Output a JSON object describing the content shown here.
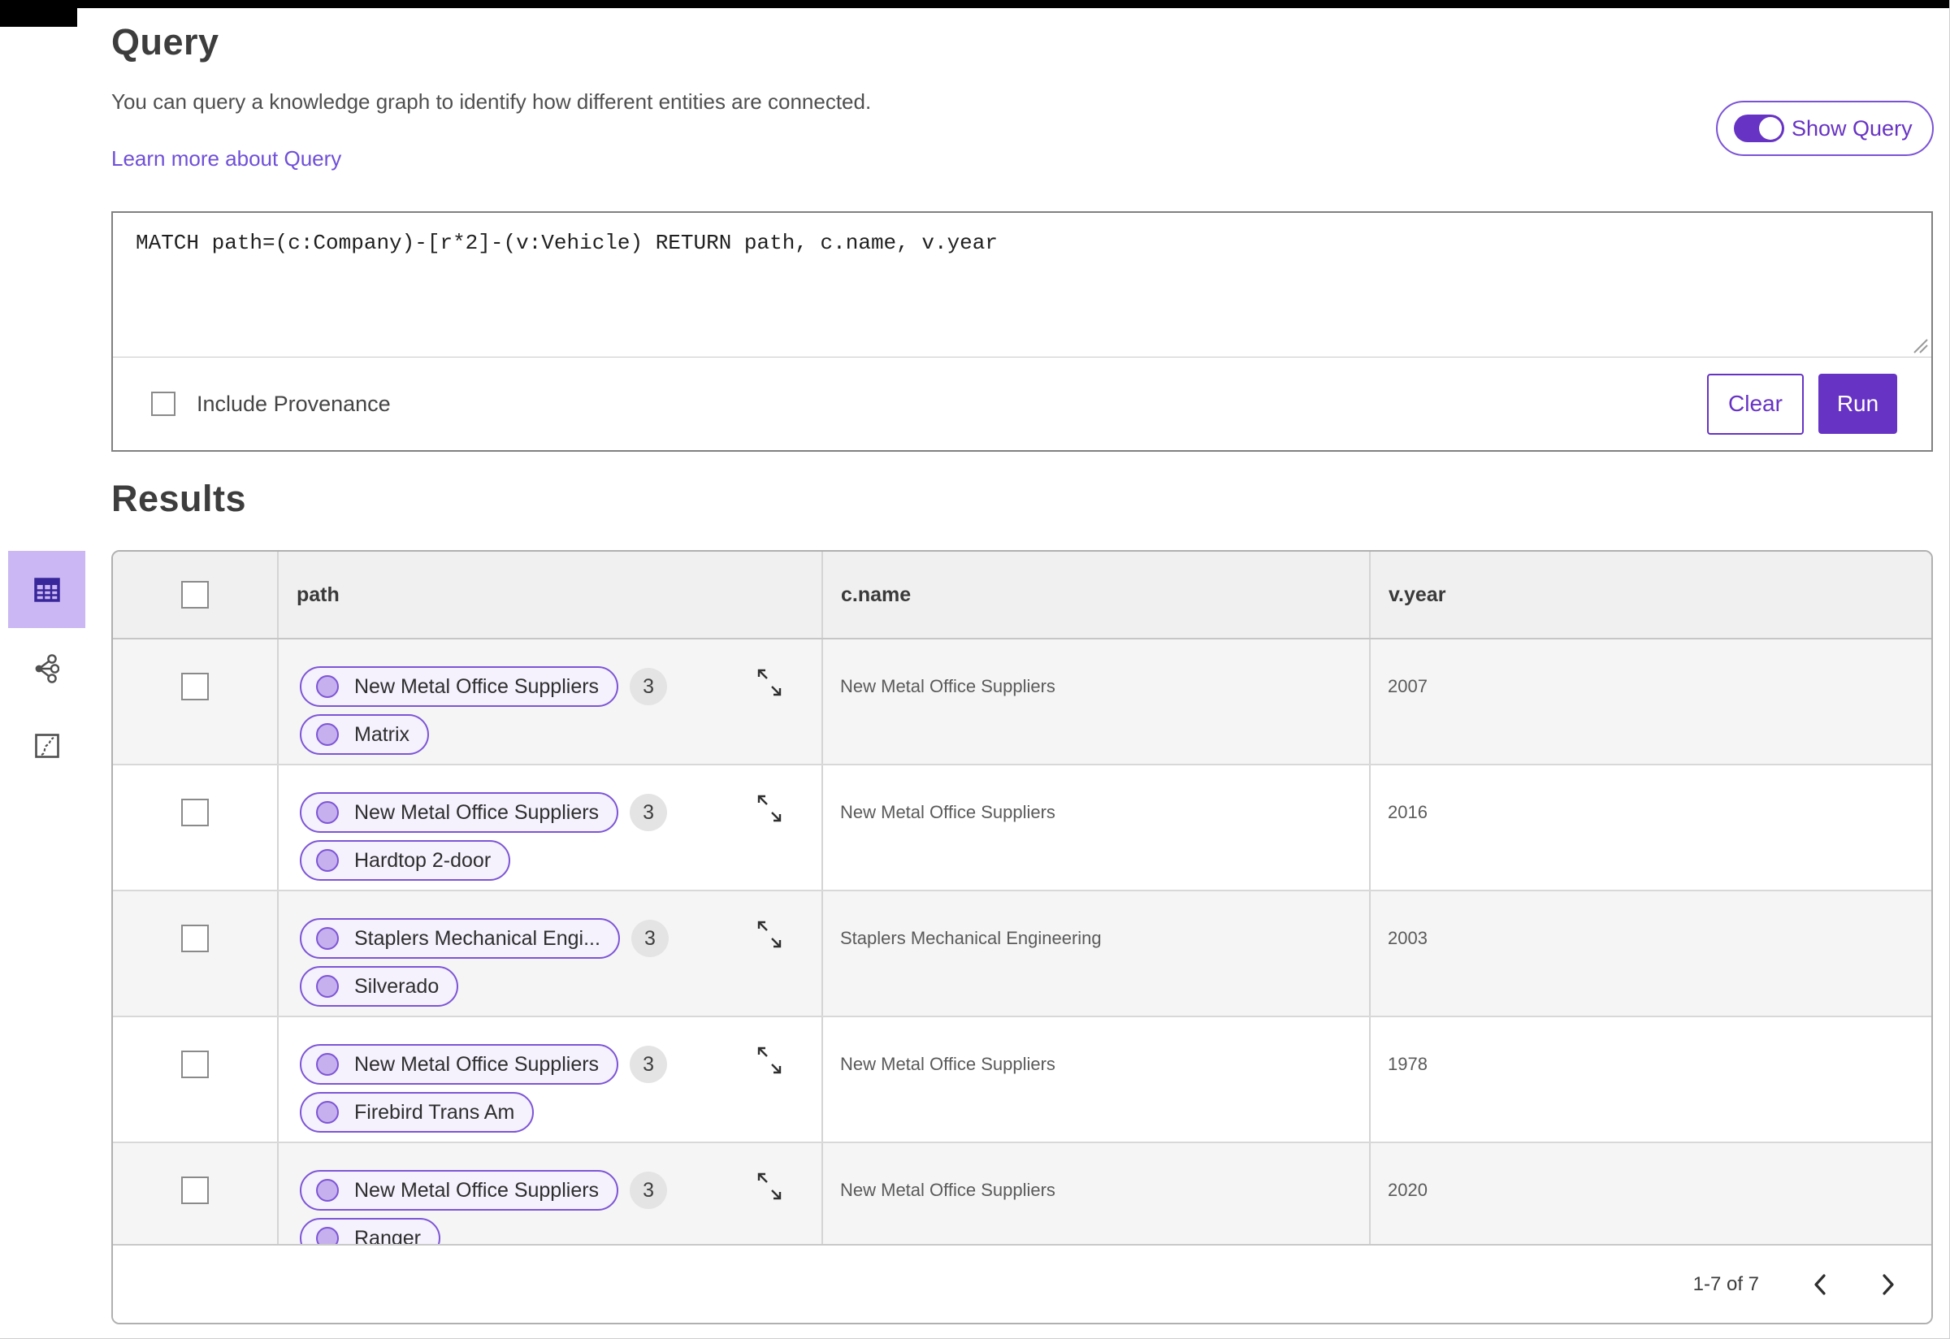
{
  "query_panel": {
    "title": "Query",
    "description": "You can query a knowledge graph to identify how different entities are connected.",
    "learn_more_link": "Learn more about Query",
    "show_query_toggle": "Show Query",
    "query_text": "MATCH path=(c:Company)-[r*2]-(v:Vehicle) RETURN path, c.name, v.year",
    "include_provenance": "Include Provenance",
    "clear_button": "Clear",
    "run_button": "Run"
  },
  "results_panel": {
    "title": "Results",
    "view_switcher": {
      "active_view": "table",
      "icons": [
        "table-view-icon",
        "graph-view-icon",
        "chart-view-icon"
      ]
    },
    "columns": [
      "path",
      "c.name",
      "v.year"
    ],
    "rows": [
      {
        "path_nodes": [
          "New Metal Office Suppliers",
          "Matrix"
        ],
        "edge_count": "3",
        "c_name": "New Metal Office Suppliers",
        "v_year": "2007"
      },
      {
        "path_nodes": [
          "New Metal Office Suppliers",
          "Hardtop 2-door"
        ],
        "edge_count": "3",
        "c_name": "New Metal Office Suppliers",
        "v_year": "2016"
      },
      {
        "path_nodes": [
          "Staplers Mechanical Engi...",
          "Silverado"
        ],
        "edge_count": "3",
        "c_name": "Staplers Mechanical Engineering",
        "v_year": "2003"
      },
      {
        "path_nodes": [
          "New Metal Office Suppliers",
          "Firebird Trans Am"
        ],
        "edge_count": "3",
        "c_name": "New Metal Office Suppliers",
        "v_year": "1978"
      },
      {
        "path_nodes": [
          "New Metal Office Suppliers",
          "Ranger"
        ],
        "edge_count": "3",
        "c_name": "New Metal Office Suppliers",
        "v_year": "2020"
      }
    ],
    "pagination": "1-7 of 7"
  },
  "colors": {
    "accent_purple": "#6733c4",
    "pill_border": "#7d55d6",
    "pill_background": "#f5f1fd",
    "node_dot_fill": "#c6b0ed",
    "active_tile": "#cbb7f3",
    "header_row_gray": "#f0f0f0",
    "alt_row_gray": "#f5f5f5"
  }
}
